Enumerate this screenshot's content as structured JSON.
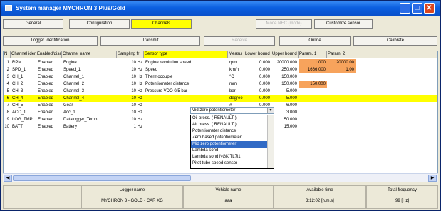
{
  "window": {
    "title": "System manager   MYCHRON 3 Plus/Gold",
    "buttons": {
      "minimize": "_",
      "maximize": "□",
      "close": "✕"
    }
  },
  "tabs_row1": [
    {
      "label": "General",
      "state": "normal"
    },
    {
      "label": "Configuration",
      "state": "normal"
    },
    {
      "label": "Channels",
      "state": "active"
    },
    {
      "label": "Mode NEC (mode)",
      "state": "disabled"
    },
    {
      "label": "Customize sensor",
      "state": "normal"
    }
  ],
  "tabs_row2": [
    {
      "label": "Logger Identification",
      "state": "normal"
    },
    {
      "label": "Transmit",
      "state": "normal"
    },
    {
      "label": "Receive",
      "state": "disabled"
    },
    {
      "label": "Online",
      "state": "normal"
    },
    {
      "label": "Calibrate",
      "state": "normal"
    }
  ],
  "table": {
    "headers": [
      "N",
      "Channel iden",
      "Enabled/disa",
      "Channel name",
      "Sampling fr",
      "Sensor type",
      "Measu",
      "Lower bound",
      "Upper bound",
      "Param. 1",
      "Param. 2"
    ],
    "rows": [
      {
        "n": "1",
        "id": "RPM",
        "enabled": "Enabled",
        "name": "Engine",
        "freq": "10 Hz",
        "sensor": "Engine revolution speed",
        "unit": "rpm",
        "lower": "0.000",
        "upper": "20000.000",
        "p1": "1.000",
        "p2": "20000.00",
        "orange": true,
        "selected": false
      },
      {
        "n": "2",
        "id": "SPD_1",
        "enabled": "Enabled",
        "name": "Speed_1",
        "freq": "10 Hz",
        "sensor": "Speed",
        "unit": "km/h",
        "lower": "0.000",
        "upper": "250.000",
        "p1": "1666.000",
        "p2": "1.00",
        "orange": true,
        "selected": false
      },
      {
        "n": "3",
        "id": "CH_1",
        "enabled": "Enabled",
        "name": "Channel_1",
        "freq": "10 Hz",
        "sensor": "Thermocouple",
        "unit": "°C",
        "lower": "0.000",
        "upper": "150.000",
        "p1": "",
        "p2": "",
        "orange": false,
        "selected": false
      },
      {
        "n": "4",
        "id": "CH_2",
        "enabled": "Enabled",
        "name": "Channel_2",
        "freq": "10 Hz",
        "sensor": "Potentiometer distance",
        "unit": "mm",
        "lower": "0.000",
        "upper": "150.000",
        "p1": "150.000",
        "p2": "",
        "orange": true,
        "selected": false
      },
      {
        "n": "5",
        "id": "CH_3",
        "enabled": "Enabled",
        "name": "Channel_3",
        "freq": "10 Hz",
        "sensor": "Pressure VDO 0/5 bar",
        "unit": "bar",
        "lower": "0.000",
        "upper": "5.000",
        "p1": "",
        "p2": "",
        "orange": false,
        "selected": false
      },
      {
        "n": "6",
        "id": "CH_4",
        "enabled": "Enabled",
        "name": "Channel_4",
        "freq": "10 Hz",
        "sensor": "",
        "unit": "degree",
        "lower": "0.000",
        "upper": "5.000",
        "p1": "",
        "p2": "",
        "orange": false,
        "selected": true
      },
      {
        "n": "7",
        "id": "CH_5",
        "enabled": "Enabled",
        "name": "Gear",
        "freq": "10 Hz",
        "sensor": "",
        "unit": "#",
        "lower": "0.000",
        "upper": "6.000",
        "p1": "",
        "p2": "",
        "orange": false,
        "selected": false
      },
      {
        "n": "8",
        "id": "ACC_1",
        "enabled": "Enabled",
        "name": "Acc_1",
        "freq": "10 Hz",
        "sensor": "",
        "unit": "g",
        "lower": "-3.000",
        "upper": "3.000",
        "p1": "",
        "p2": "",
        "orange": false,
        "selected": false
      },
      {
        "n": "9",
        "id": "LOG_TMP",
        "enabled": "Enabled",
        "name": "Datalogger_Temp",
        "freq": "10 Hz",
        "sensor": "",
        "unit": "°C",
        "lower": "0.000",
        "upper": "50.000",
        "p1": "",
        "p2": "",
        "orange": false,
        "selected": false
      },
      {
        "n": "10",
        "id": "BATT",
        "enabled": "Enabled",
        "name": "Battery",
        "freq": "1 Hz",
        "sensor": "",
        "unit": "V",
        "lower": "5.000",
        "upper": "15.000",
        "p1": "",
        "p2": "",
        "orange": false,
        "selected": false
      }
    ]
  },
  "combo": {
    "value": "Mid zero potentiometer"
  },
  "dropdown": {
    "items": [
      "Oil press. ( RENAULT )",
      "Air press. ( RENAULT )",
      "Potentiometer distance",
      "Zero based potentiometer",
      "Mid zero potentiometer",
      "Lambda sond",
      "Lambda sond NGK TL7l1",
      "Pitot tube speed sensor"
    ],
    "highlighted": 4
  },
  "footer": [
    {
      "label": "Logger name",
      "value": "MYCHRON 3 - GOLD - CAR XG"
    },
    {
      "label": "Vehicle name",
      "value": "aaa"
    },
    {
      "label": "Available time",
      "value": "3:12:02 [h.m.s]"
    },
    {
      "label": "Total frequency",
      "value": "99 [Hz]"
    }
  ],
  "colors": {
    "active_tab": "#ffff00",
    "param_highlight": "#f7a35c",
    "titlebar": "#0b5fe0"
  }
}
